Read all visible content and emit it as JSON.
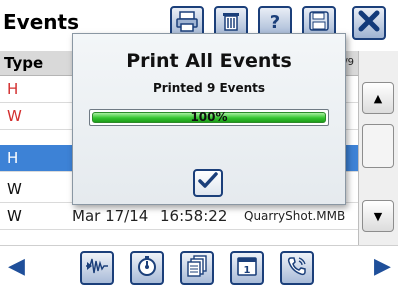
{
  "window": {
    "title": "Events"
  },
  "toolbar": {
    "buttons": [
      {
        "name": "print-button",
        "icon": "print-icon"
      },
      {
        "name": "delete-button",
        "icon": "trash-icon"
      },
      {
        "name": "help-button",
        "icon": "help-icon"
      },
      {
        "name": "save-button",
        "icon": "disk-icon"
      },
      {
        "name": "close-button",
        "icon": "close-icon"
      }
    ]
  },
  "table": {
    "header": {
      "type_label": "Type",
      "page": "3/9"
    },
    "rows": [
      {
        "type": "H",
        "type_color": "#d32f2f",
        "date": "",
        "time": "",
        "file": ""
      },
      {
        "type": "W",
        "type_color": "#d32f2f",
        "date": "",
        "time": "",
        "file": ""
      },
      {
        "type": "H",
        "type_color": "#ffffff",
        "date": "",
        "time": "",
        "file": "",
        "selected": true
      },
      {
        "type": "W",
        "type_color": "#111111",
        "date": "",
        "time": "",
        "file": ""
      },
      {
        "type": "W",
        "type_color": "#111111",
        "date": "Mar 17/14",
        "time": "16:58:22",
        "file": "QuarryShot.MMB"
      }
    ]
  },
  "scroll": {
    "up_glyph": "▲",
    "down_glyph": "▼"
  },
  "modal": {
    "title": "Print All Events",
    "status": "Printed 9 Events",
    "progress_percent": 100,
    "progress_label": "100%",
    "ok_icon": "checkmark-icon"
  },
  "bottom_toolbar": {
    "prev_glyph": "◀",
    "next_glyph": "▶",
    "buttons": [
      {
        "name": "waveform-button",
        "icon": "waveform-icon"
      },
      {
        "name": "stopwatch-button",
        "icon": "stopwatch-icon"
      },
      {
        "name": "documents-button",
        "icon": "documents-icon"
      },
      {
        "name": "calendar-button",
        "icon": "calendar-icon"
      },
      {
        "name": "phone-button",
        "icon": "phone-icon"
      }
    ]
  },
  "colors": {
    "accent": "#1b3f7a",
    "selection": "#3d82d6",
    "progress": "#33c42f",
    "close_x": "#123a7a"
  }
}
